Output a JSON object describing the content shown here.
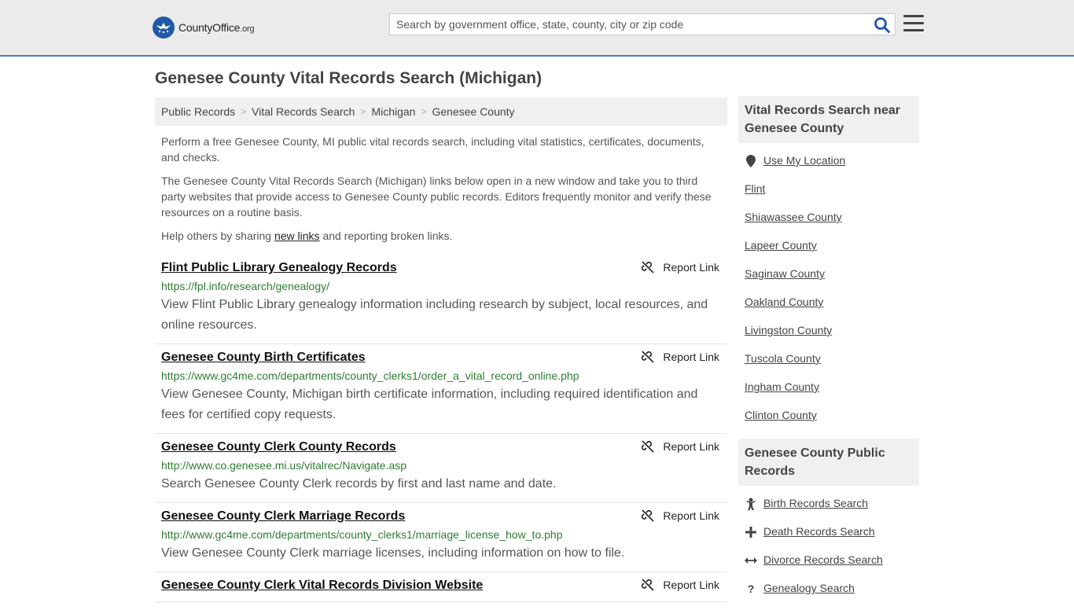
{
  "header": {
    "logo_main": "CountyOffice",
    "logo_tld": ".org",
    "search_placeholder": "Search by government office, state, county, city or zip code"
  },
  "page": {
    "title": "Genesee County Vital Records Search (Michigan)"
  },
  "breadcrumb": [
    "Public Records",
    "Vital Records Search",
    "Michigan",
    "Genesee County"
  ],
  "intro": {
    "p1": "Perform a free Genesee County, MI public vital records search, including vital statistics, certificates, documents, and checks.",
    "p2": "The Genesee County Vital Records Search (Michigan) links below open in a new window and take you to third party websites that provide access to Genesee County public records. Editors frequently monitor and verify these resources on a routine basis.",
    "p3_before": "Help others by sharing ",
    "p3_link": "new links",
    "p3_after": " and reporting broken links."
  },
  "report_label": "Report Link",
  "links": [
    {
      "title": "Flint Public Library Genealogy Records",
      "url": "https://fpl.info/research/genealogy/",
      "desc": "View Flint Public Library genealogy information including research by subject, local resources, and online resources."
    },
    {
      "title": "Genesee County Birth Certificates",
      "url": "https://www.gc4me.com/departments/county_clerks1/order_a_vital_record_online.php",
      "desc": "View Genesee County, Michigan birth certificate information, including required identification and fees for certified copy requests."
    },
    {
      "title": "Genesee County Clerk County Records",
      "url": "http://www.co.genesee.mi.us/vitalrec/Navigate.asp",
      "desc": "Search Genesee County Clerk records by first and last name and date."
    },
    {
      "title": "Genesee County Clerk Marriage Records",
      "url": "http://www.gc4me.com/departments/county_clerks1/marriage_license_how_to.php",
      "desc": "View Genesee County Clerk marriage licenses, including information on how to file."
    },
    {
      "title": "Genesee County Clerk Vital Records Division Website",
      "url": "",
      "desc": ""
    }
  ],
  "sidebar": {
    "near_title": "Vital Records Search near Genesee County",
    "use_location": "Use My Location",
    "near_items": [
      "Flint",
      "Shiawassee County",
      "Lapeer County",
      "Saginaw County",
      "Oakland County",
      "Livingston County",
      "Tuscola County",
      "Ingham County",
      "Clinton County"
    ],
    "records_title": "Genesee County Public Records",
    "records_items": [
      "Birth Records Search",
      "Death Records Search",
      "Divorce Records Search",
      "Genealogy Search"
    ]
  },
  "colors": {
    "brand_blue": "#1f5aa6",
    "url_green": "#2e7d32",
    "header_bg": "#ebebeb"
  }
}
